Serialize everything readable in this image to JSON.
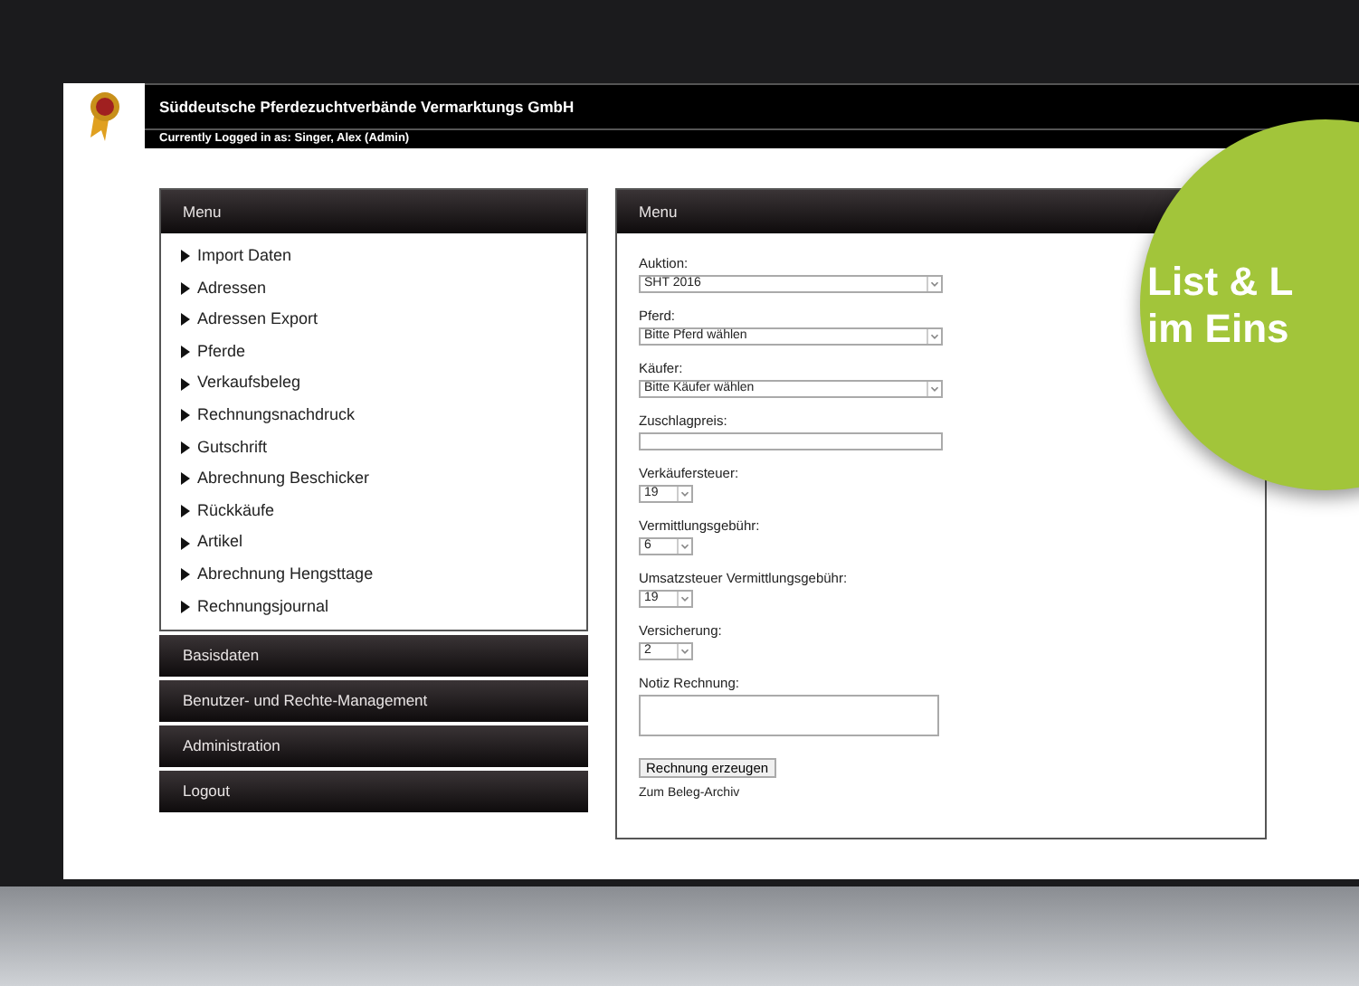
{
  "header": {
    "company": "Süddeutsche Pferdezuchtverbände Vermarktungs GmbH",
    "login": "Currently Logged in as: Singer, Alex (Admin)"
  },
  "menu": {
    "title": "Menu",
    "items": [
      "Import Daten",
      "Adressen",
      "Adressen Export",
      "Pferde",
      "Verkaufsbeleg",
      "Rechnungsnachdruck",
      "Gutschrift",
      "Abrechnung Beschicker",
      "Rückkäufe",
      "Artikel",
      "Abrechnung Hengsttage",
      "Rechnungsjournal"
    ]
  },
  "sections": [
    "Basisdaten",
    "Benutzer- und Rechte-Management",
    "Administration",
    "Logout"
  ],
  "form": {
    "title": "Menu",
    "fields": [
      {
        "label": "Auktion:",
        "kind": "select",
        "value": "SHT 2016",
        "wide": true
      },
      {
        "label": "Pferd:",
        "kind": "select",
        "value": "Bitte Pferd wählen",
        "wide": true
      },
      {
        "label": "Käufer:",
        "kind": "select",
        "value": "Bitte Käufer wählen",
        "wide": true
      },
      {
        "label": "Zuschlagpreis:",
        "kind": "text"
      },
      {
        "label": "Verkäufersteuer:",
        "kind": "select",
        "value": "19",
        "wide": false
      },
      {
        "label": "Vermittlungsgebühr:",
        "kind": "select",
        "value": "6",
        "wide": false
      },
      {
        "label": "Umsatzsteuer Vermittlungsgebühr:",
        "kind": "select",
        "value": "19",
        "wide": false
      },
      {
        "label": "Versicherung:",
        "kind": "select",
        "value": "2",
        "wide": false
      },
      {
        "label": "Notiz Rechnung:",
        "kind": "textarea"
      }
    ],
    "button": "Rechnung erzeugen",
    "link": "Zum Beleg-Archiv"
  },
  "badge": {
    "lines": [
      "List & L",
      "im Eins"
    ]
  }
}
